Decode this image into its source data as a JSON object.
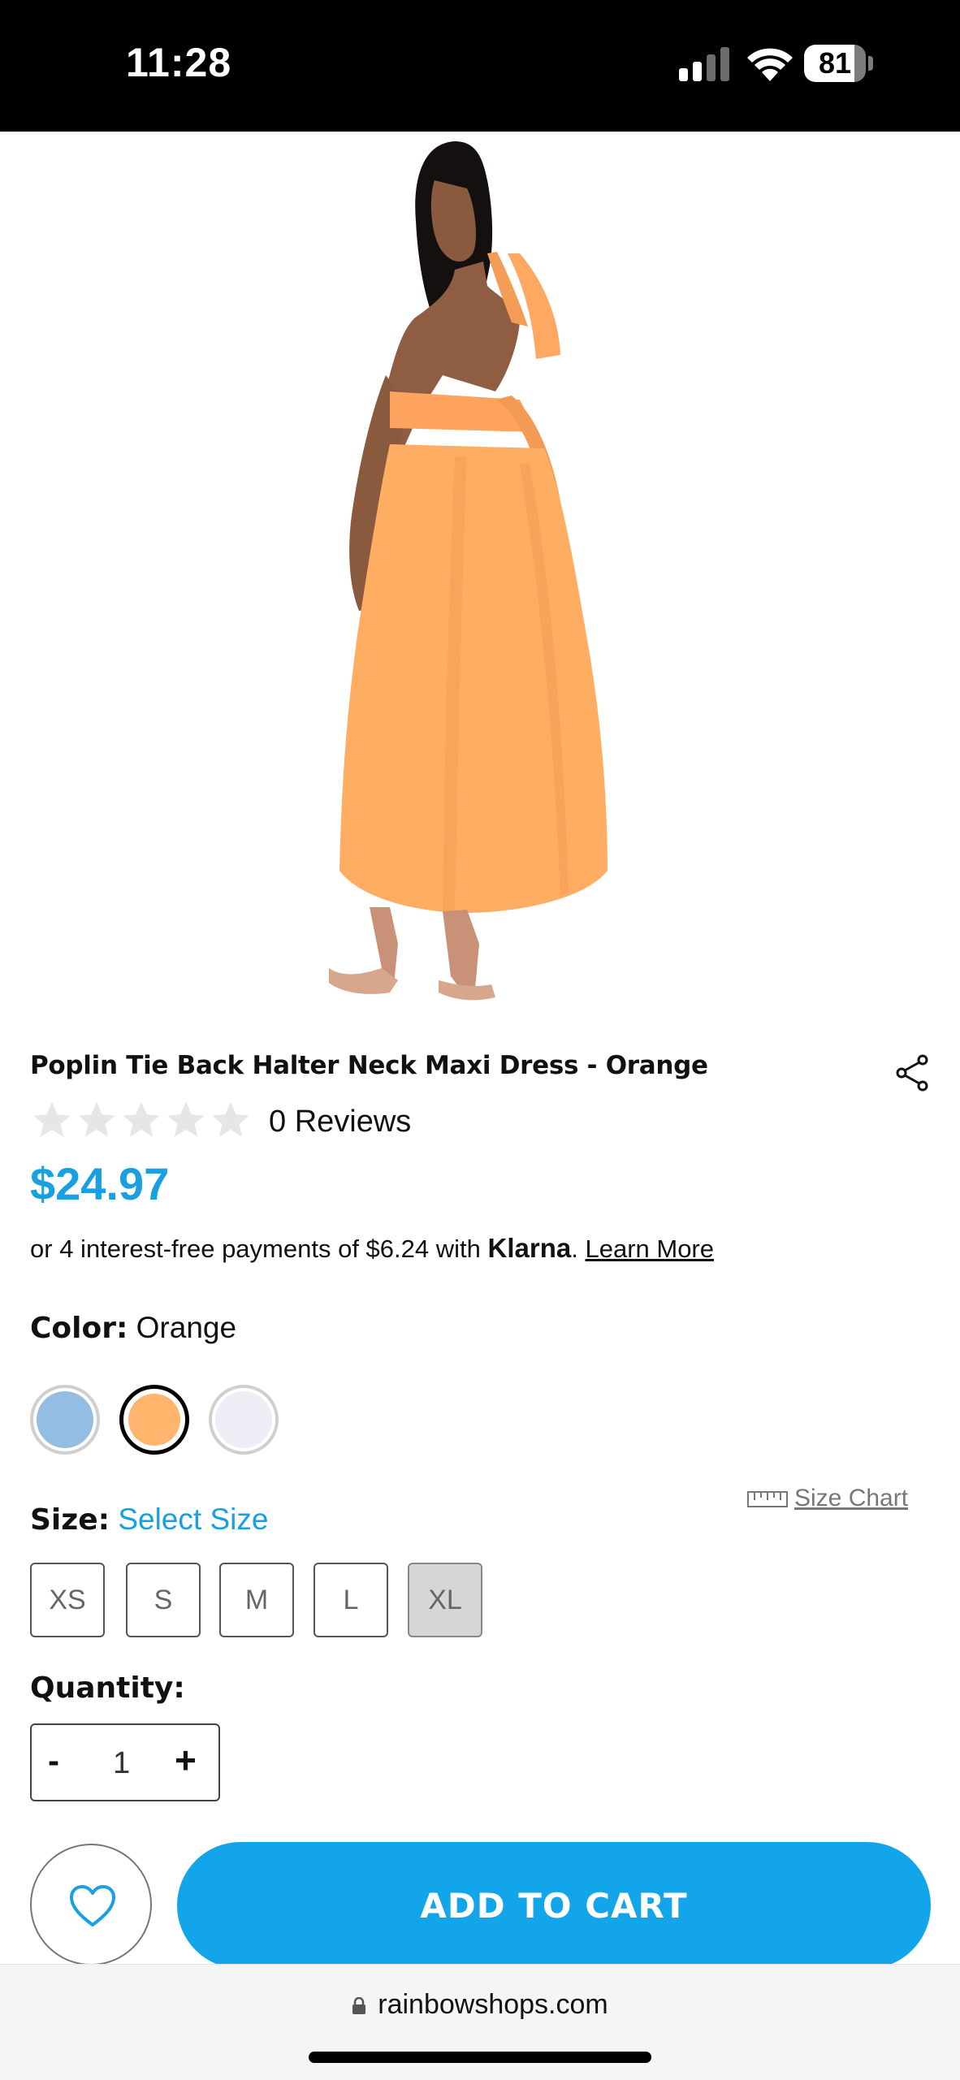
{
  "status_bar": {
    "time": "11:28",
    "battery": "81",
    "battery_level": 0.81
  },
  "product": {
    "title": "Poplin Tie Back Halter Neck Maxi Dress - Orange",
    "rating": 0,
    "reviews_label": "0 Reviews",
    "price": "$24.97",
    "image_icon": "product-photo-orange-dress"
  },
  "klarna": {
    "prefix": "or",
    "text": "4 interest-free payments of $6.24 with",
    "brand": "Klarna",
    "dot": ".",
    "learn_more": "Learn More"
  },
  "color": {
    "label": "Color:",
    "value": "Orange",
    "swatches": [
      {
        "name": "blue",
        "hex": "#94bde4",
        "selected": false
      },
      {
        "name": "orange",
        "hex": "#ffb56b",
        "selected": true
      },
      {
        "name": "white",
        "hex": "#eeeff6",
        "selected": false
      }
    ]
  },
  "size": {
    "label": "Size:",
    "value": "Select Size",
    "chart_label": "Size Chart",
    "options": [
      {
        "label": "XS",
        "available": true
      },
      {
        "label": "S",
        "available": true
      },
      {
        "label": "M",
        "available": true
      },
      {
        "label": "L",
        "available": true
      },
      {
        "label": "XL",
        "available": false
      }
    ]
  },
  "quantity": {
    "label": "Quantity:",
    "minus": "-",
    "value": "1",
    "plus": "+"
  },
  "actions": {
    "add_to_cart": "ADD TO CART",
    "wishlist_icon": "heart-icon"
  },
  "browser": {
    "url": "rainbowshops.com"
  },
  "colors": {
    "accent": "#1a9fe0",
    "button": "#12a5ea"
  }
}
